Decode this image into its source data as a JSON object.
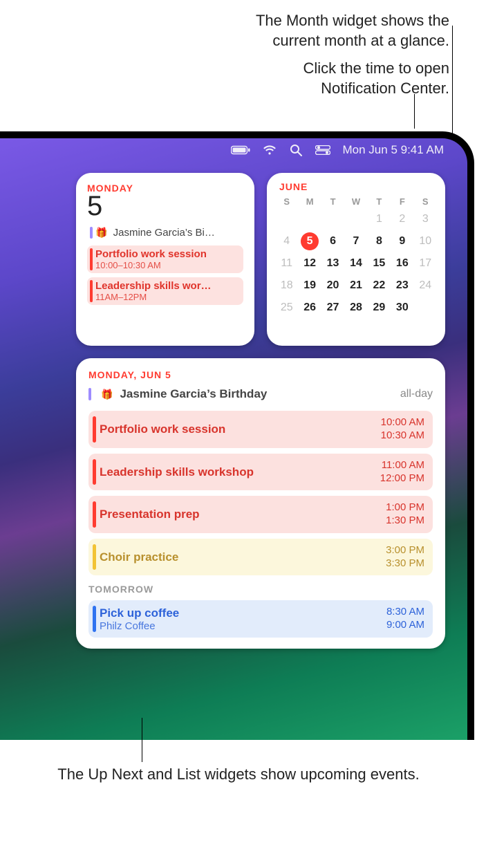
{
  "annotations": {
    "month": "The Month widget shows the\ncurrent month at a glance.",
    "time": "Click the time to open\nNotification Center.",
    "bottom": "The Up Next and List widgets\nshow upcoming events."
  },
  "menubar": {
    "datetime": "Mon Jun 5  9:41 AM"
  },
  "upnext": {
    "day_label": "MONDAY",
    "day_num": "5",
    "events": [
      {
        "title": "Jasmine Garcia’s Bi…",
        "time": "",
        "kind": "bday"
      },
      {
        "title": "Portfolio work session",
        "time": "10:00–10:30 AM",
        "kind": "red"
      },
      {
        "title": "Leadership skills wor…",
        "time": "11AM–12PM",
        "kind": "red"
      }
    ]
  },
  "month": {
    "label": "JUNE",
    "dow": [
      "S",
      "M",
      "T",
      "W",
      "T",
      "F",
      "S"
    ],
    "cells": [
      [
        "",
        "",
        "",
        "",
        "1",
        "2",
        "3"
      ],
      [
        "4",
        "5",
        "6",
        "7",
        "8",
        "9",
        "10"
      ],
      [
        "11",
        "12",
        "13",
        "14",
        "15",
        "16",
        "17"
      ],
      [
        "18",
        "19",
        "20",
        "21",
        "22",
        "23",
        "24"
      ],
      [
        "25",
        "26",
        "27",
        "28",
        "29",
        "30",
        ""
      ]
    ],
    "today": "5",
    "out_month_days": [
      "1",
      "2",
      "3",
      "4",
      "10",
      "11",
      "17",
      "18",
      "24",
      "25"
    ]
  },
  "list": {
    "heading": "MONDAY, JUN 5",
    "all_day": {
      "title": "Jasmine Garcia’s Birthday",
      "label": "all-day"
    },
    "events": [
      {
        "title": "Portfolio work session",
        "start": "10:00 AM",
        "end": "10:30 AM",
        "color": "red"
      },
      {
        "title": "Leadership skills workshop",
        "start": "11:00 AM",
        "end": "12:00 PM",
        "color": "red"
      },
      {
        "title": "Presentation prep",
        "start": "1:00 PM",
        "end": "1:30 PM",
        "color": "red"
      },
      {
        "title": "Choir practice",
        "start": "3:00 PM",
        "end": "3:30 PM",
        "color": "yellow"
      }
    ],
    "tomorrow_label": "TOMORROW",
    "tomorrow_events": [
      {
        "title": "Pick up coffee",
        "subtitle": "Philz Coffee",
        "start": "8:30 AM",
        "end": "9:00 AM",
        "color": "blue"
      }
    ]
  }
}
